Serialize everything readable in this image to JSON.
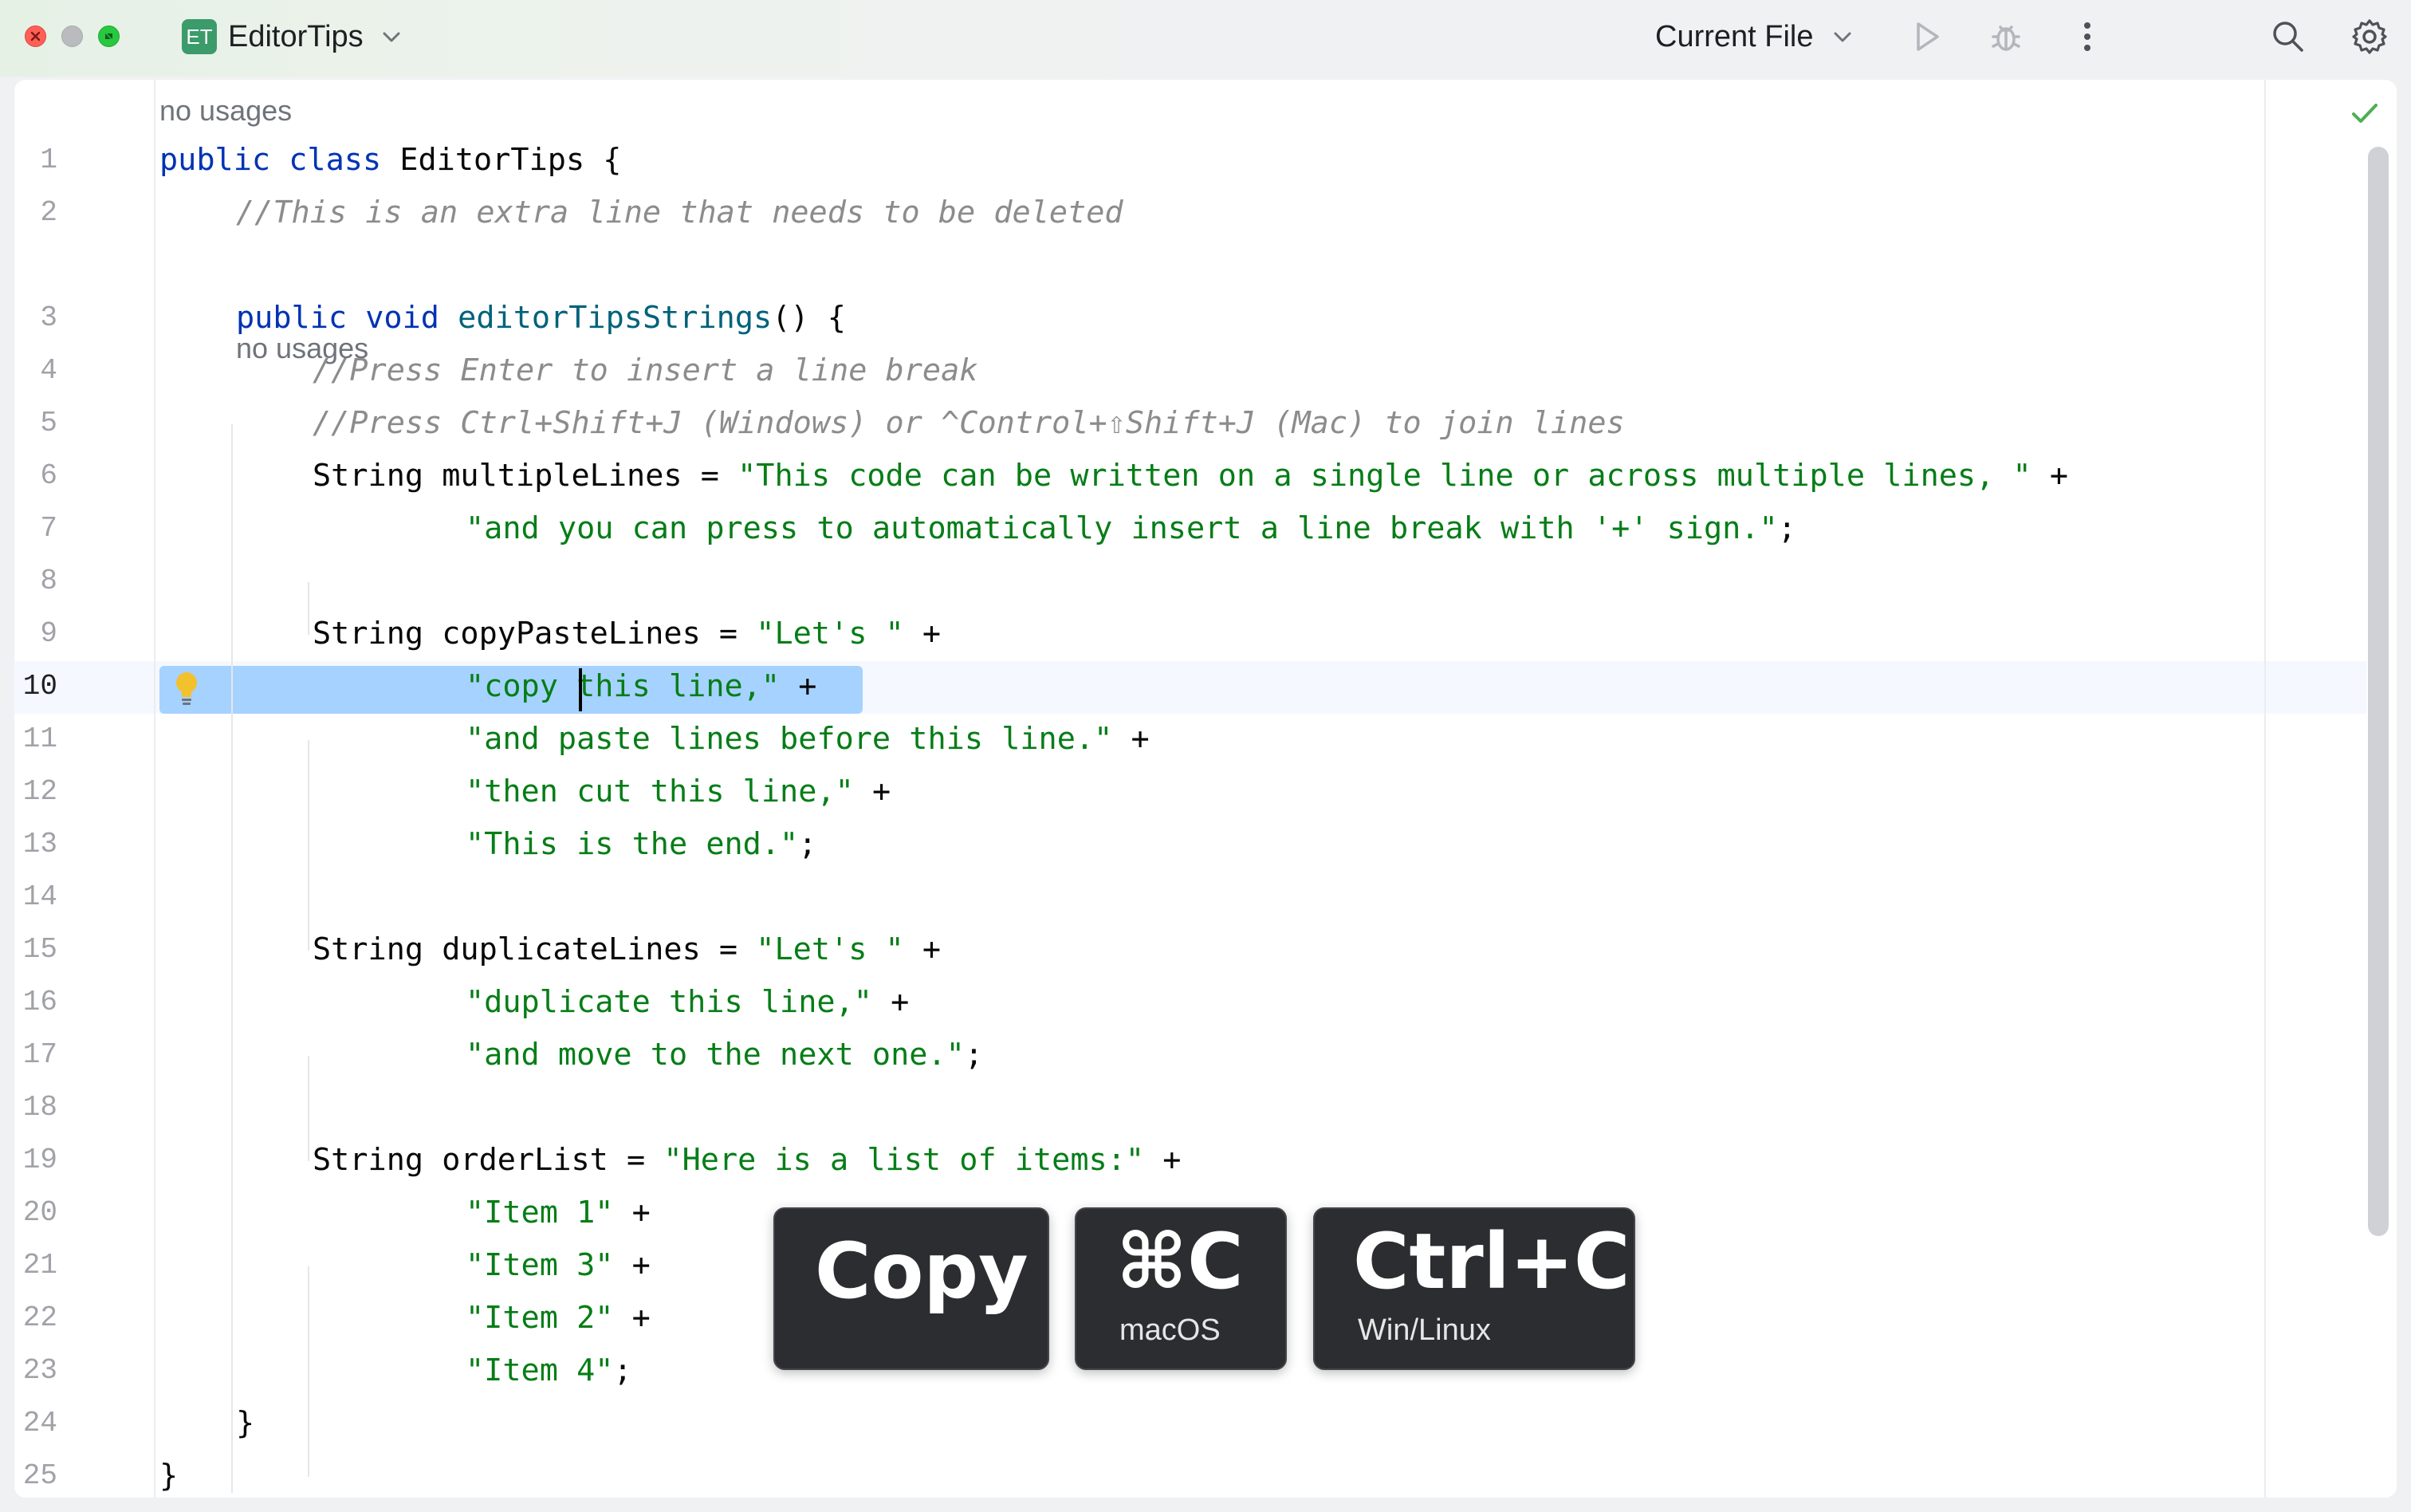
{
  "titlebar": {
    "project_badge": "ET",
    "project_name": "EditorTips",
    "run_config": "Current File",
    "icons": [
      "close-icon",
      "minimize-icon",
      "zoom-icon",
      "chevron-down-icon",
      "run-icon",
      "debug-icon",
      "more-vertical-icon",
      "search-icon",
      "settings-gear-icon"
    ]
  },
  "editor": {
    "inlay_hint_class": "no usages",
    "inlay_hint_method": "no usages",
    "current_line": 10,
    "lines": [
      {
        "n": "1",
        "parts": [
          [
            "kw",
            "public class "
          ],
          [
            "",
            "EditorTips {"
          ]
        ]
      },
      {
        "n": "2",
        "parts": [
          [
            "cm",
            "//This is an extra line that needs to be deleted"
          ]
        ]
      },
      {
        "n": "3",
        "parts": [
          [
            "kw",
            "public void "
          ],
          [
            "fn",
            "editorTipsStrings"
          ],
          [
            "",
            "() {"
          ]
        ]
      },
      {
        "n": "4",
        "parts": [
          [
            "cm",
            "//Press Enter to insert a line break"
          ]
        ]
      },
      {
        "n": "5",
        "parts": [
          [
            "cm",
            "//Press Ctrl+Shift+J (Windows) or ^Control+⇧Shift+J (Mac) to join lines"
          ]
        ]
      },
      {
        "n": "6",
        "parts": [
          [
            "",
            "String multipleLines = "
          ],
          [
            "str",
            "\"This code can be written on a single line or across multiple lines, \""
          ],
          [
            "",
            " +"
          ]
        ]
      },
      {
        "n": "7",
        "parts": [
          [
            "str",
            "\"and you can press to automatically insert a line break with '+' sign.\""
          ],
          [
            "",
            ";"
          ]
        ]
      },
      {
        "n": "8",
        "parts": []
      },
      {
        "n": "9",
        "parts": [
          [
            "",
            "String copyPasteLines = "
          ],
          [
            "str",
            "\"Let's \""
          ],
          [
            "",
            " +"
          ]
        ]
      },
      {
        "n": "10",
        "parts": [
          [
            "str",
            "\"copy this line,\""
          ],
          [
            "",
            " +"
          ]
        ]
      },
      {
        "n": "11",
        "parts": [
          [
            "str",
            "\"and paste lines before this line.\""
          ],
          [
            "",
            " +"
          ]
        ]
      },
      {
        "n": "12",
        "parts": [
          [
            "str",
            "\"then cut this line,\""
          ],
          [
            "",
            " +"
          ]
        ]
      },
      {
        "n": "13",
        "parts": [
          [
            "str",
            "\"This is the end.\""
          ],
          [
            "",
            ";"
          ]
        ]
      },
      {
        "n": "14",
        "parts": []
      },
      {
        "n": "15",
        "parts": [
          [
            "",
            "String duplicateLines = "
          ],
          [
            "str",
            "\"Let's \""
          ],
          [
            "",
            " +"
          ]
        ]
      },
      {
        "n": "16",
        "parts": [
          [
            "str",
            "\"duplicate this line,\""
          ],
          [
            "",
            " +"
          ]
        ]
      },
      {
        "n": "17",
        "parts": [
          [
            "str",
            "\"and move to the next one.\""
          ],
          [
            "",
            ";"
          ]
        ]
      },
      {
        "n": "18",
        "parts": []
      },
      {
        "n": "19",
        "parts": [
          [
            "",
            "String orderList = "
          ],
          [
            "str",
            "\"Here is a list of items:\""
          ],
          [
            "",
            " +"
          ]
        ]
      },
      {
        "n": "20",
        "parts": [
          [
            "str",
            "\"Item 1\""
          ],
          [
            "",
            " +"
          ]
        ]
      },
      {
        "n": "21",
        "parts": [
          [
            "str",
            "\"Item 3\""
          ],
          [
            "",
            " +"
          ]
        ]
      },
      {
        "n": "22",
        "parts": [
          [
            "str",
            "\"Item 2\""
          ],
          [
            "",
            " +"
          ]
        ]
      },
      {
        "n": "23",
        "parts": [
          [
            "str",
            "\"Item 4\""
          ],
          [
            "",
            ";"
          ]
        ]
      },
      {
        "n": "24",
        "parts": [
          [
            "",
            "}"
          ]
        ]
      },
      {
        "n": "25",
        "parts": [
          [
            "",
            "}"
          ]
        ]
      }
    ]
  },
  "overlay": {
    "action": "Copy",
    "mac_shortcut": "⌘C",
    "mac_label": "macOS",
    "win_shortcut": "Ctrl+C",
    "win_label": "Win/Linux"
  },
  "colors": {
    "keyword": "#0033b3",
    "string": "#067d17",
    "comment": "#8c8c8c",
    "method": "#00627a",
    "selection": "#a6d2ff",
    "project_badge": "#3b9b6b"
  }
}
